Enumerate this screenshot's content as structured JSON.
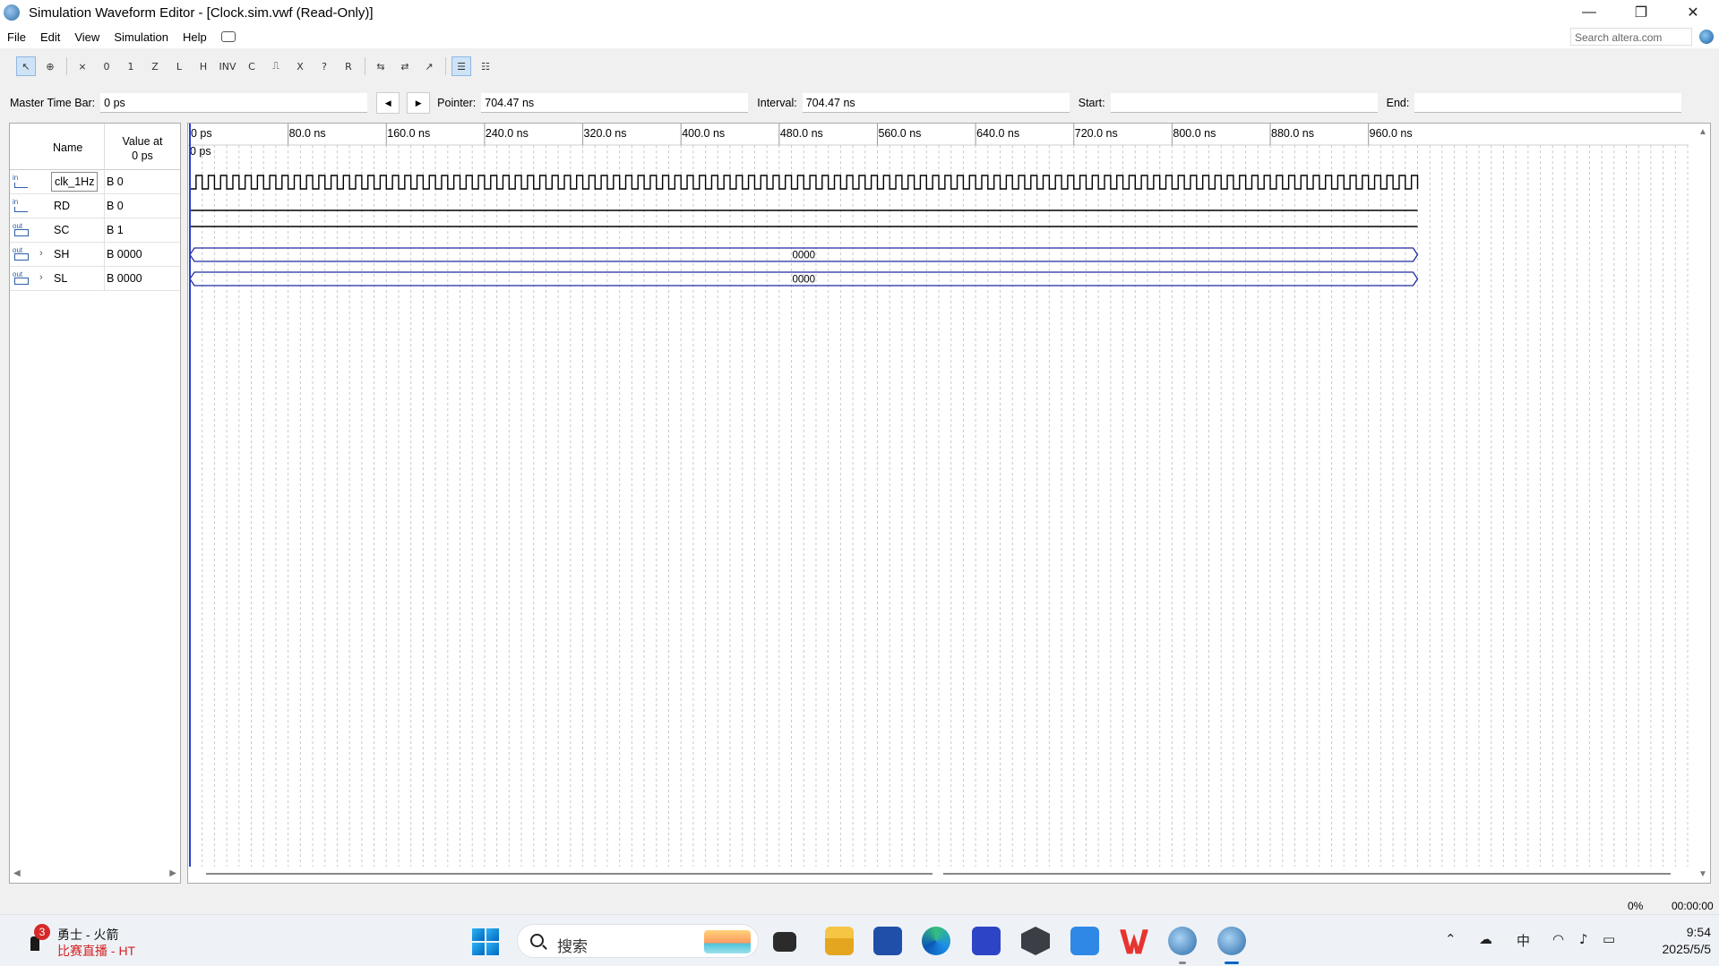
{
  "window": {
    "title": "Simulation Waveform Editor - [Clock.sim.vwf (Read-Only)]",
    "controls": [
      "minimize",
      "restore",
      "close"
    ]
  },
  "menu": {
    "items": [
      "File",
      "Edit",
      "View",
      "Simulation",
      "Help"
    ],
    "search_placeholder": "Search altera.com"
  },
  "toolbar": {
    "icons": [
      "selection-tool",
      "zoom-tool",
      "uninitialized",
      "forcing-low",
      "forcing-high",
      "high-impedance",
      "weak-low",
      "weak-high",
      "invert",
      "count-value",
      "clock",
      "random-value",
      "dont-care",
      "arbitrary-value",
      "group",
      "ungroup",
      "insert-node",
      "snap-to-grid",
      "sort"
    ]
  },
  "timebar": {
    "master_label": "Master Time Bar:",
    "master_value": "0 ps",
    "pointer_label": "Pointer:",
    "pointer_value": "704.47 ns",
    "interval_label": "Interval:",
    "interval_value": "704.47 ns",
    "start_label": "Start:",
    "start_value": "",
    "end_label": "End:",
    "end_value": ""
  },
  "signal_list": {
    "header_name": "Name",
    "header_value_line1": "Value at",
    "header_value_line2": "0 ps",
    "signals": [
      {
        "type": "in",
        "name": "clk_1Hz",
        "value": "B 0",
        "expandable": false,
        "selected": true
      },
      {
        "type": "in",
        "name": "RD",
        "value": "B 0",
        "expandable": false,
        "selected": false
      },
      {
        "type": "out",
        "name": "SC",
        "value": "B 1",
        "expandable": false,
        "selected": false
      },
      {
        "type": "out",
        "name": "SH",
        "value": "B 0000",
        "expandable": true,
        "selected": false
      },
      {
        "type": "out",
        "name": "SL",
        "value": "B 0000",
        "expandable": true,
        "selected": false
      }
    ]
  },
  "waveform": {
    "cursor_label": "0 ps",
    "time_labels": [
      "0 ps",
      "80.0 ns",
      "160.0 ns",
      "240.0 ns",
      "320.0 ns",
      "400.0 ns",
      "480.0 ns",
      "560.0 ns",
      "640.0 ns",
      "720.0 ns",
      "800.0 ns",
      "880.0 ns",
      "960.0 ns"
    ],
    "time_range_ns": [
      0,
      1000
    ],
    "clock_period_ns": 10,
    "grid_step_ns": 10,
    "signals": [
      {
        "name": "clk_1Hz",
        "kind": "clock",
        "initial": 0
      },
      {
        "name": "RD",
        "kind": "bit",
        "level": 0
      },
      {
        "name": "SC",
        "kind": "bit",
        "level": 1
      },
      {
        "name": "SH",
        "kind": "bus",
        "value": "0000"
      },
      {
        "name": "SL",
        "kind": "bus",
        "value": "0000"
      }
    ],
    "colors": {
      "bus": "#1f2a9e",
      "cursor": "#2b3fcf",
      "grid": "#c9c9c9",
      "signal": "#000000"
    }
  },
  "statusbar": {
    "percent": "0%",
    "elapsed": "00:00:00"
  },
  "taskbar": {
    "news_badge": "3",
    "news_title": "勇士 - 火箭",
    "news_subtitle": "比赛直播 - HT",
    "search_placeholder": "搜索",
    "apps": [
      "task-view",
      "file-explorer",
      "microsoft-store",
      "edge",
      "app-m",
      "app-hex",
      "app-a",
      "wps-office",
      "quartus",
      "quartus-active"
    ],
    "tray_ime": "中",
    "time": "9:54",
    "date": "2025/5/5"
  }
}
